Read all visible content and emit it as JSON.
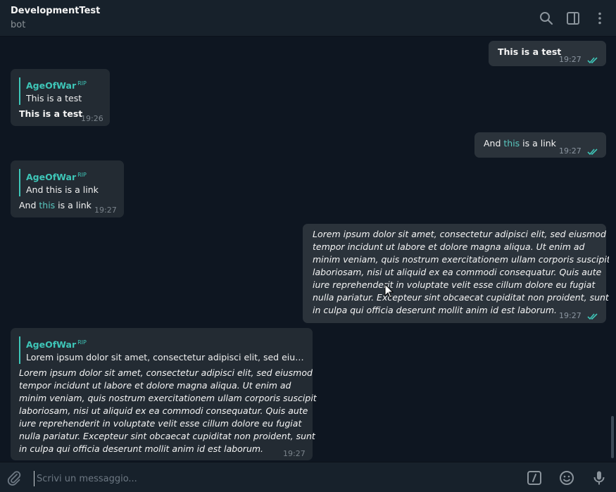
{
  "header": {
    "title": "DevelopmentTest",
    "subtitle": "bot"
  },
  "messages": [
    {
      "direction": "out",
      "text": "This is a test",
      "time": "19:27",
      "status": "read"
    },
    {
      "direction": "in",
      "reply_author": "AgeOfWar",
      "reply_badge": "RIP",
      "reply_text": "This is a test",
      "text": "This is a test",
      "time": "19:26"
    },
    {
      "direction": "out",
      "text_before": "And ",
      "link": "this",
      "text_after": " is a link",
      "time": "19:27",
      "status": "read"
    },
    {
      "direction": "in",
      "reply_author": "AgeOfWar",
      "reply_badge": "RIP",
      "reply_text": "And this is a link",
      "text_before": "And ",
      "link": "this",
      "text_after": " is a link",
      "time": "19:27"
    },
    {
      "direction": "out",
      "lines": [
        "Lorem ipsum dolor sit amet, consectetur adipisci elit, sed eiusmod",
        "tempor incidunt ut labore et dolore magna aliqua. Ut enim ad",
        "minim veniam, quis nostrum exercitationem ullam corporis suscipit",
        "laboriosam, nisi ut aliquid ex ea commodi consequatur. Quis aute",
        "iure reprehenderit in voluptate velit esse cillum dolore eu fugiat",
        "nulla pariatur. Excepteur sint obcaecat cupiditat non proident, sunt",
        "in culpa qui officia deserunt mollit anim id est laborum."
      ],
      "time": "19:27",
      "status": "read"
    },
    {
      "direction": "in",
      "reply_author": "AgeOfWar",
      "reply_badge": "RIP",
      "reply_text": "Lorem ipsum dolor sit amet, consectetur adipisci elit, sed eiusmo...",
      "lines": [
        "Lorem ipsum dolor sit amet, consectetur adipisci elit, sed eiusmod",
        "tempor incidunt ut labore et dolore magna aliqua. Ut enim ad",
        "minim veniam, quis nostrum exercitationem ullam corporis suscipit",
        "laboriosam, nisi ut aliquid ex ea commodi consequatur. Quis aute",
        "iure reprehenderit in voluptate velit esse cillum dolore eu fugiat",
        "nulla pariatur. Excepteur sint obcaecat cupiditat non proident, sunt",
        "in culpa qui officia deserunt mollit anim id est laborum."
      ],
      "time": "19:27"
    }
  ],
  "composer": {
    "placeholder": "Scrivi un messaggio..."
  },
  "icons": {
    "header": [
      "search-icon",
      "sidebar-toggle-icon",
      "more-vertical-icon"
    ],
    "composer": [
      "attach-icon",
      "bot-commands-icon",
      "emoji-icon",
      "microphone-icon"
    ]
  },
  "colors": {
    "background": "#0e1621",
    "panel": "#17212b",
    "accent": "#3ec6b8",
    "link": "#5ac8c0"
  }
}
